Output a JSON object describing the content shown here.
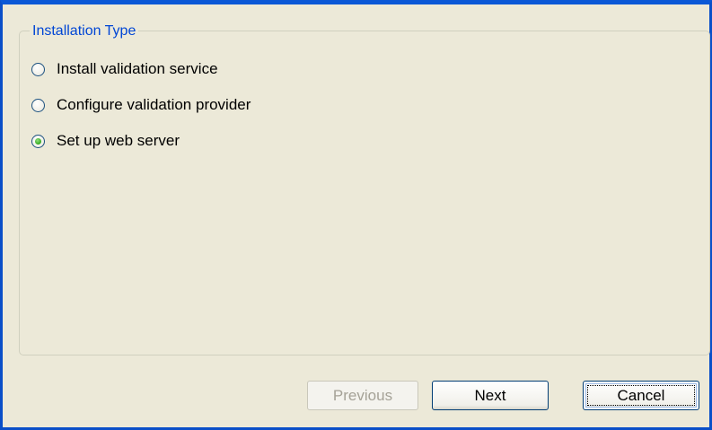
{
  "groupbox": {
    "title": "Installation Type",
    "options": [
      {
        "label": "Install validation service",
        "selected": false
      },
      {
        "label": "Configure validation provider",
        "selected": false
      },
      {
        "label": "Set up web server",
        "selected": true
      }
    ]
  },
  "buttons": {
    "previous": {
      "label": "Previous",
      "enabled": false
    },
    "next": {
      "label": "Next",
      "enabled": true
    },
    "cancel": {
      "label": "Cancel",
      "enabled": true,
      "focused": true
    }
  },
  "colors": {
    "window_border": "#0a58d6",
    "dialog_background": "#ece9d8",
    "group_title": "#0046d5",
    "radio_selected_dot": "#32a81c",
    "disabled_text": "#a5a297"
  }
}
